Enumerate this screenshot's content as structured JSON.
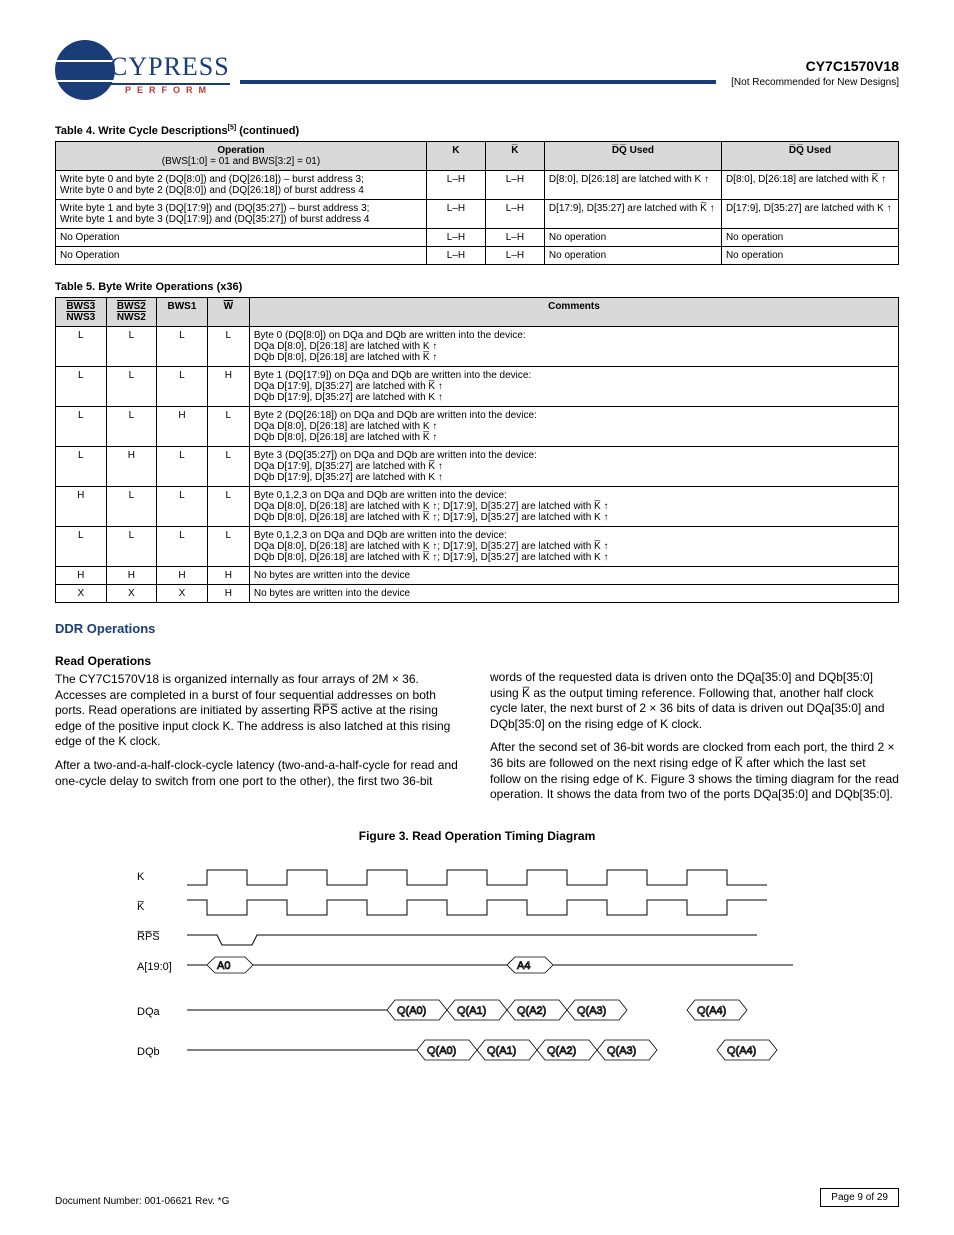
{
  "header": {
    "logo_main": "CYPRESS",
    "logo_sub": "PERFORM",
    "model": "CY7C1570V18",
    "subnote": "[Not Recommended for New Designs]"
  },
  "table4": {
    "title_prefix": "Table 4.  Write Cycle Descriptions",
    "title_suffix": " (continued)",
    "footnote_ref": "[5]",
    "headers": [
      "Operation",
      "K",
      "K̅",
      "D̅Q̅ Used",
      "D̅Q̅ Used"
    ],
    "sub_headers": [
      "(BWS[1:0] = 01 and BWS[3:2] = 01)",
      "",
      "",
      "",
      ""
    ],
    "rows": [
      {
        "op": "Write byte 0 and byte 2 (DQ[8:0]) and (DQ[26:18]) – burst address 3;\nWrite byte 0 and byte 2 (DQ[8:0]) and (DQ[26:18]) of burst address 4",
        "K": "L–H",
        "Kb": "L–H",
        "dq1": "D[8:0], D[26:18] are latched with K ↑",
        "dq2": "D[8:0], D[26:18] are latched with K̅ ↑"
      },
      {
        "op": "Write byte 1 and byte 3 (DQ[17:9]) and (DQ[35:27]) – burst address 3;\nWrite byte 1 and byte 3 (DQ[17:9]) and (DQ[35:27]) of burst address 4",
        "K": "L–H",
        "Kb": "L–H",
        "dq1": "D[17:9], D[35:27] are latched with K̅ ↑",
        "dq2": "D[17:9], D[35:27] are latched with K ↑"
      },
      {
        "op": "No Operation",
        "K": "L–H",
        "Kb": "L–H",
        "dq1": "No operation",
        "dq2": "No operation"
      },
      {
        "op": "No Operation",
        "K": "L–H",
        "Kb": "L–H",
        "dq1": "No operation",
        "dq2": "No operation"
      }
    ]
  },
  "table5": {
    "title": "Table 5.  Byte Write Operations (x36)",
    "headers": [
      "BWS3\nNWS3",
      "BWS2\nNWS2",
      "BWS1",
      "W",
      "Comments"
    ],
    "rows": [
      {
        "c": [
          "L",
          "L",
          "L",
          "L"
        ],
        "cm": "Byte 0 (DQ[8:0]) on DQa and DQb are written into the device:\nDQa D[8:0], D[26:18] are latched with K ↑\nDQb D[8:0], D[26:18] are latched with K̅ ↑"
      },
      {
        "c": [
          "L",
          "L",
          "L",
          "H"
        ],
        "cm": "Byte 1 (DQ[17:9]) on DQa and DQb are written into the device:\nDQa D[17:9], D[35:27] are latched with K̅ ↑\nDQb D[17:9], D[35:27] are latched with K ↑"
      },
      {
        "c": [
          "L",
          "L",
          "H",
          "L"
        ],
        "cm": "Byte 2 (DQ[26:18]) on DQa and DQb are written into the device:\nDQa D[8:0], D[26:18] are latched with K ↑\nDQb D[8:0], D[26:18] are latched with K̅ ↑"
      },
      {
        "c": [
          "L",
          "H",
          "L",
          "L"
        ],
        "cm": "Byte 3 (DQ[35:27]) on DQa and DQb are written into the device:\nDQa D[17:9], D[35:27] are latched with K̅ ↑\nDQb D[17:9], D[35:27] are latched with K ↑"
      },
      {
        "c": [
          "H",
          "L",
          "L",
          "L"
        ],
        "cm": "Byte 0,1,2,3 on DQa and DQb are written into the device:\nDQa D[8:0], D[26:18] are latched with K ↑; D[17:9], D[35:27] are latched with K̅ ↑\nDQb D[8:0], D[26:18] are latched with K̅ ↑; D[17:9], D[35:27] are latched with K ↑"
      },
      {
        "c": [
          "L",
          "L",
          "L",
          "L"
        ],
        "cm": "Byte 0,1,2,3 on DQa and DQb are written into the device:\nDQa D[8:0], D[26:18] are latched with K ↑; D[17:9], D[35:27] are latched with K̅ ↑\nDQb D[8:0], D[26:18] are latched with K̅ ↑; D[17:9], D[35:27] are latched with K ↑"
      },
      {
        "c": [
          "H",
          "H",
          "H",
          "H"
        ],
        "cm": "No bytes are written into the device"
      },
      {
        "c": [
          "X",
          "X",
          "X",
          "H"
        ],
        "cm": "No bytes are written into the device"
      }
    ]
  },
  "ddr": {
    "heading": "DDR Operations",
    "read_head": "Read Operations",
    "read_body_1": "The CY7C1570V18 is organized internally as four arrays of 2M × 36. Accesses are completed in a burst of four sequential addresses on both ports. Read operations are initiated by asserting R̅P̅S̅ active at the rising edge of the positive input clock K. The address is also latched at this rising edge of the K clock.",
    "read_body_2": "After a two-and-a-half-clock-cycle latency (two-and-a-half-cycle for read and one-cycle delay to switch from one port to the other), the first two 36-bit words of the requested data is driven onto the DQa[35:0] and DQb[35:0] using K̅ as the output timing reference. Following that, another half clock cycle later, the next burst of 2 × 36 bits of data is driven out DQa[35:0] and DQb[35:0] on the rising edge of K clock.",
    "read_body_3": "After the second set of 36-bit words are clocked from each port, the third 2 × 36 bits are followed on the next rising edge of K̅ after which the last set follow on the rising edge of K. Figure 3 shows the timing diagram for the read operation. It shows the data from two of the ports DQa[35:0] and DQb[35:0].",
    "fig_title": "Figure 3.  Read Operation Timing Diagram",
    "sig": {
      "k": "K",
      "kb": "K̅",
      "rps": "R̅P̅S̅",
      "addr": "A[19:0]",
      "dqa": "DQa",
      "dqb": "DQb",
      "a0": "A0",
      "a4": "A4",
      "cells": [
        "Q(A0)",
        "Q(A1)",
        "Q(A2)",
        "Q(A3)",
        "Q(A4)"
      ]
    }
  },
  "footer": {
    "doc": "Document Number: 001-06621 Rev. *G",
    "page": "Page 9 of 29"
  }
}
